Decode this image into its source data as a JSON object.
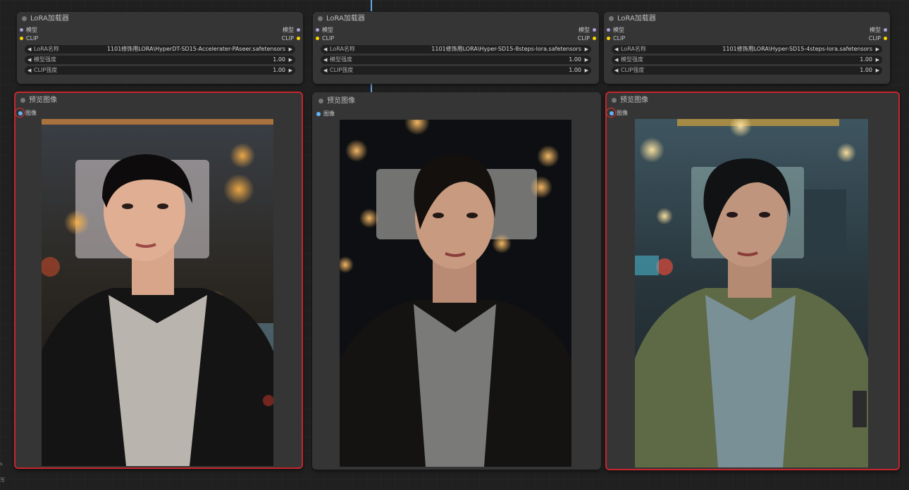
{
  "colors": {
    "canvas": "#202020",
    "node_bg": "#353535",
    "widget_bg": "#1f1f1f",
    "selection": "#c6262e",
    "model_slot": "#b39ddb",
    "clip_slot": "#ffd500",
    "image_slot": "#64b5f6",
    "link": "#6aa8e8"
  },
  "lora_nodes": [
    {
      "title": "LoRA加载器",
      "input_model": "模型",
      "output_model": "模型",
      "input_clip": "CLIP",
      "output_clip": "CLIP",
      "lora_label": "LoRA名称",
      "lora_value": "1101修饰用LORA\\HyperDT-SD15-Accelerater-PAseer.safetensors",
      "model_strength_label": "模型强度",
      "model_strength_value": "1.00",
      "clip_strength_label": "CLIP强度",
      "clip_strength_value": "1.00"
    },
    {
      "title": "LoRA加载器",
      "input_model": "模型",
      "output_model": "模型",
      "input_clip": "CLIP",
      "output_clip": "CLIP",
      "lora_label": "LoRA名称",
      "lora_value": "1101修饰用LORA\\Hyper-SD15-8steps-lora.safetensors",
      "model_strength_label": "模型强度",
      "model_strength_value": "1.00",
      "clip_strength_label": "CLIP强度",
      "clip_strength_value": "1.00"
    },
    {
      "title": "LoRA加载器",
      "input_model": "模型",
      "output_model": "模型",
      "input_clip": "CLIP",
      "output_clip": "CLIP",
      "lora_label": "LoRA名称",
      "lora_value": "1101修饰用LORA\\Hyper-SD15-4steps-lora.safetensors",
      "model_strength_label": "模型强度",
      "model_strength_value": "1.00",
      "clip_strength_label": "CLIP强度",
      "clip_strength_value": "1.00"
    }
  ],
  "preview_nodes": [
    {
      "title": "预览图像",
      "input_image": "图像",
      "selected": true,
      "image_alt": "portrait-black-leather-jacket"
    },
    {
      "title": "预览图像",
      "input_image": "图像",
      "selected": false,
      "image_alt": "portrait-black-leather-jacket-dark-bokeh"
    },
    {
      "title": "预览图像",
      "input_image": "图像",
      "selected": true,
      "image_alt": "portrait-olive-green-jacket"
    }
  ],
  "side_text": {
    "top": "s",
    "bottom": "写"
  }
}
